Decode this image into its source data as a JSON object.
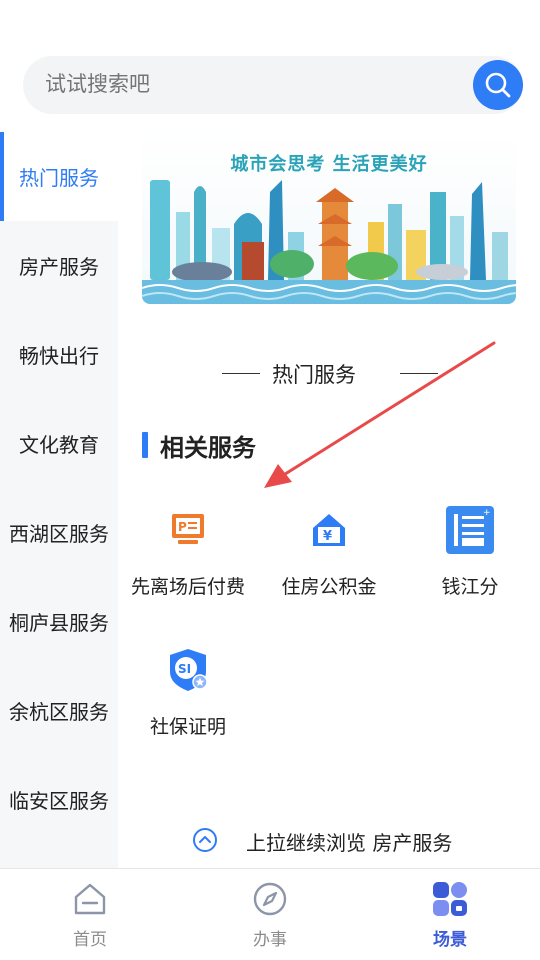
{
  "search": {
    "placeholder": "试试搜索吧",
    "icon": "search-icon",
    "accent": "#2e7cf6"
  },
  "sidebar": {
    "items": [
      {
        "label": "热门服务",
        "active": true
      },
      {
        "label": "房产服务"
      },
      {
        "label": "畅快出行"
      },
      {
        "label": "文化教育"
      },
      {
        "label": "西湖区服务"
      },
      {
        "label": "桐庐县服务"
      },
      {
        "label": "余杭区服务"
      },
      {
        "label": "临安区服务"
      }
    ]
  },
  "banner": {
    "title": "城市会思考 生活更美好"
  },
  "hot_section": {
    "label": "热门服务"
  },
  "related": {
    "title": "相关服务",
    "services": [
      {
        "label": "先离场后付费",
        "icon": "parking-payment-icon"
      },
      {
        "label": "住房公积金",
        "icon": "housing-fund-icon"
      },
      {
        "label": "钱江分",
        "icon": "credit-score-icon"
      },
      {
        "label": "社保证明",
        "icon": "social-security-icon"
      }
    ]
  },
  "pullup": {
    "text": "上拉继续浏览  房产服务",
    "icon": "chevron-up-icon"
  },
  "tabbar": {
    "tabs": [
      {
        "label": "首页",
        "icon": "home-icon"
      },
      {
        "label": "办事",
        "icon": "compass-icon"
      },
      {
        "label": "场景",
        "icon": "scene-grid-icon",
        "active": true
      }
    ]
  },
  "colors": {
    "primary": "#2e7cf6",
    "tab_active": "#3c5bd6",
    "orange": "#f07a2c",
    "annotation": "#e84a4a"
  }
}
